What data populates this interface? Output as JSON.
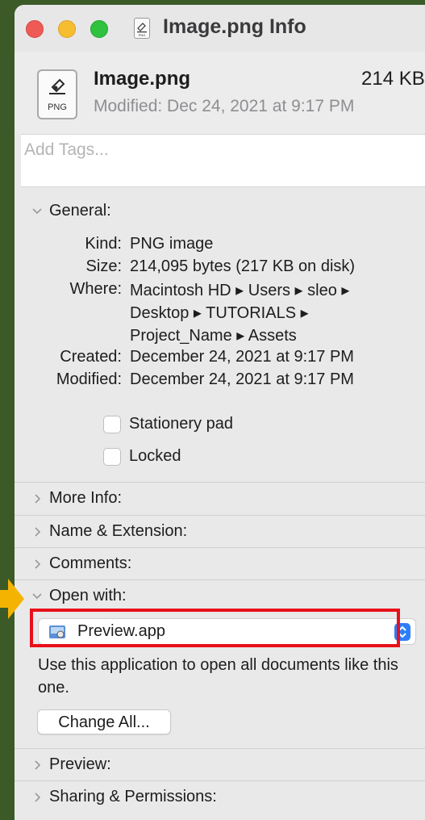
{
  "window": {
    "title": "Image.png Info",
    "title_icon": "png-document-icon"
  },
  "header": {
    "file_name": "Image.png",
    "file_size": "214 KB",
    "modified": "Modified: Dec 24, 2021 at 9:17 PM",
    "file_icon_label": "PNG"
  },
  "tags": {
    "placeholder": "Add Tags..."
  },
  "general": {
    "label": "General:",
    "kind_label": "Kind:",
    "kind_value": "PNG image",
    "size_label": "Size:",
    "size_value": "214,095 bytes (217 KB on disk)",
    "where_label": "Where:",
    "where_line1": "Macintosh HD ▸ Users ▸ sleo ▸",
    "where_line2": "Desktop ▸ TUTORIALS ▸",
    "where_line3": "Project_Name ▸ Assets",
    "created_label": "Created:",
    "created_value": "December 24, 2021 at 9:17 PM",
    "modified_label": "Modified:",
    "modified_value": "December 24, 2021 at 9:17 PM",
    "stationery_label": "Stationery pad",
    "locked_label": "Locked"
  },
  "sections": {
    "more_info": "More Info:",
    "name_ext": "Name & Extension:",
    "comments": "Comments:",
    "open_with": "Open with:",
    "preview": "Preview:",
    "sharing": "Sharing & Permissions:"
  },
  "open_with": {
    "app": "Preview.app",
    "description": "Use this application to open all documents like this one.",
    "change_all": "Change All..."
  },
  "colors": {
    "background": "#3b5a27",
    "window": "#e9e9e9",
    "highlight": "#e8101a",
    "arrow": "#f5b301",
    "accent": "#2d7ff9"
  }
}
